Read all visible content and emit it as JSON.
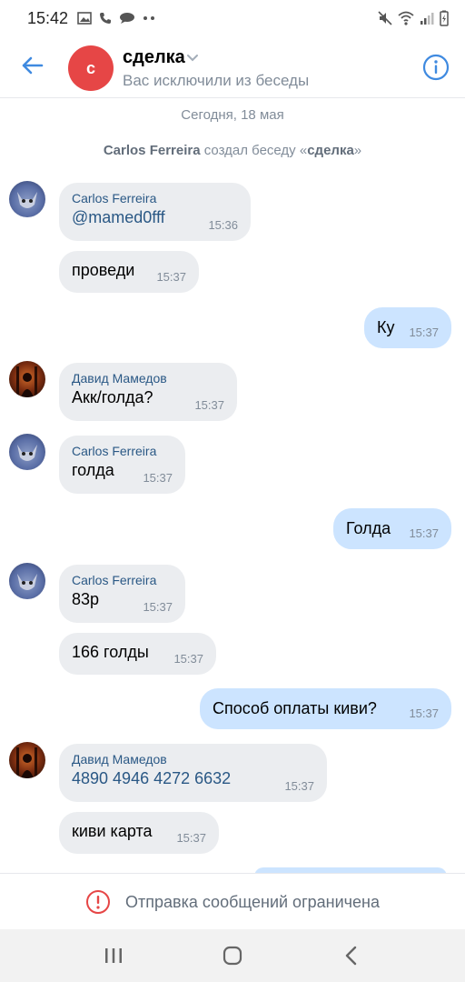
{
  "status_bar": {
    "time": "15:42"
  },
  "header": {
    "avatar_letter": "с",
    "title": "сделка",
    "subtitle": "Вас исключили из беседы"
  },
  "date_separator": "Сегодня, 18 мая",
  "system_message": {
    "actor": "Carlos Ferreira",
    "action": " создал беседу «",
    "chat_name": "сделка",
    "close": "»"
  },
  "messages": [
    {
      "author": "Carlos Ferreira",
      "text": "@mamed0fff",
      "time": "15:36"
    },
    {
      "text": "проведи",
      "time": "15:37"
    },
    {
      "text": "Ку",
      "time": "15:37"
    },
    {
      "author": "Давид Мамедов",
      "text": "Акк/голда?",
      "time": "15:37"
    },
    {
      "author": "Carlos Ferreira",
      "text": "голда",
      "time": "15:37"
    },
    {
      "text": "Голда",
      "time": "15:37"
    },
    {
      "author": "Carlos Ferreira",
      "text": "83р",
      "time": "15:37"
    },
    {
      "text": "166 голды",
      "time": "15:37"
    },
    {
      "text": "Способ оплаты киви?",
      "time": "15:37"
    },
    {
      "author": "Давид Мамедов",
      "text": "4890 4946 4272 6632",
      "time": "15:37"
    },
    {
      "text": "киви карта",
      "time": "15:37"
    }
  ],
  "restriction": {
    "text": "Отправка сообщений ограничена"
  },
  "colors": {
    "accent": "#3f8ae0",
    "incoming_bubble": "#ebedf0",
    "outgoing_bubble": "#cce4ff",
    "avatar_red": "#e64646",
    "alert_red": "#e64646"
  },
  "icons": [
    "back-arrow-icon",
    "chevron-down-icon",
    "info-icon",
    "alert-icon",
    "recent-apps-icon",
    "home-icon",
    "back-nav-icon"
  ]
}
